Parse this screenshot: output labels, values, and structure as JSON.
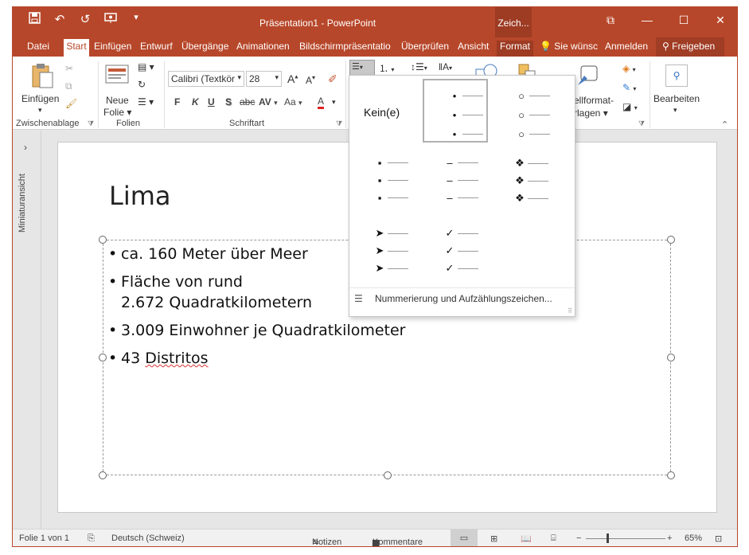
{
  "window": {
    "title": "Präsentation1 - PowerPoint",
    "context_tab_header": "Zeich...",
    "qat": {
      "save_icon": "save-icon",
      "undo_icon": "undo-icon",
      "redo_icon": "redo-icon",
      "present_icon": "present-icon",
      "customize_icon": "customize-icon"
    },
    "buttons": {
      "restore": "⧉",
      "minimize": "—",
      "maximize": "☐",
      "close": "✕"
    }
  },
  "tabs": [
    {
      "label": "Datei"
    },
    {
      "label": "Start"
    },
    {
      "label": "Einfügen"
    },
    {
      "label": "Entwurf"
    },
    {
      "label": "Übergänge"
    },
    {
      "label": "Animationen"
    },
    {
      "label": "Bildschirmpräsentatio"
    },
    {
      "label": "Überprüfen"
    },
    {
      "label": "Ansicht"
    },
    {
      "label": "Format"
    }
  ],
  "tell_me": "Sie wünsc",
  "sign_in": "Anmelden",
  "share": "Freigeben",
  "ribbon": {
    "clipboard": {
      "paste": "Einfügen",
      "label": "Zwischenablage"
    },
    "slides": {
      "new_slide_line1": "Neue",
      "new_slide_line2": "Folie",
      "label": "Folien"
    },
    "font": {
      "font_name": "Calibri (Textkör",
      "font_size": "28",
      "bold": "F",
      "italic": "K",
      "underline": "U",
      "shadow": "S",
      "strike": "abc",
      "spacing": "AV",
      "case": "Aa",
      "color": "A",
      "grow": "A",
      "shrink": "A",
      "label": "Schriftart"
    },
    "styles": {
      "label_line1": "ellformat-",
      "label_line2": "rlagen"
    },
    "editing": {
      "label": "Bearbeiten"
    }
  },
  "slide": {
    "title": "Lima",
    "bullets": [
      {
        "lines": [
          "ca. 160 Meter über Meer"
        ]
      },
      {
        "lines": [
          "Fläche von rund",
          "2.672 Quadratkilometern"
        ]
      },
      {
        "lines": [
          "3.009 Einwohner je Quadratkilometer"
        ]
      },
      {
        "number": "43",
        "word": "Distritos"
      }
    ]
  },
  "thumbnails": {
    "label": "Miniaturansicht",
    "expand": "›"
  },
  "bullet_gallery": {
    "none_label": "Kein(e)",
    "styles": [
      {
        "symbol": "•"
      },
      {
        "symbol": "○"
      },
      {
        "symbol": "▪"
      },
      {
        "symbol": "–"
      },
      {
        "symbol": "❖"
      },
      {
        "symbol": "➤"
      },
      {
        "symbol": "✓"
      }
    ],
    "footer": "Nummerierung und Aufzählungszeichen..."
  },
  "status": {
    "slide_info": "Folie 1 von 1",
    "language": "Deutsch (Schweiz)",
    "notes": "Notizen",
    "comments": "Kommentare",
    "zoom": "65%"
  }
}
